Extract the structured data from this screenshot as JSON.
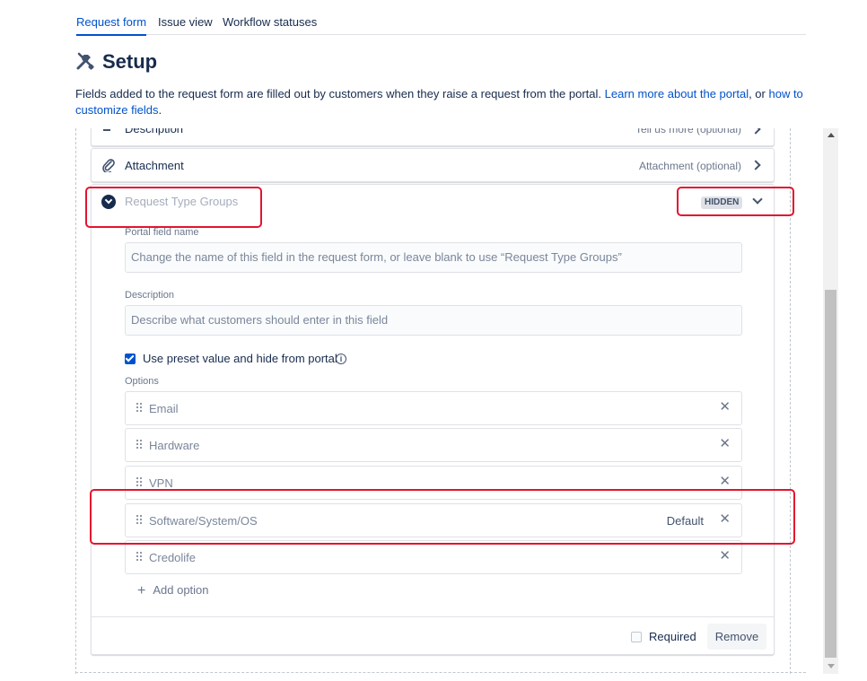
{
  "tabs": [
    {
      "label": "Request form",
      "active": true
    },
    {
      "label": "Issue view",
      "active": false
    },
    {
      "label": "Workflow statuses",
      "active": false
    }
  ],
  "page": {
    "title": "Setup",
    "icon": "tools-icon",
    "intro": {
      "text_before": "Fields added to the request form are filled out by customers when they raise a request from the portal. ",
      "link1": "Learn more about the portal",
      "text_between": ", or ",
      "link2": "how to customize fields",
      "text_after": "."
    }
  },
  "fields": {
    "description": {
      "label": "Description",
      "hint": "Tell us more (optional)"
    },
    "attachment": {
      "label": "Attachment",
      "hint": "Attachment (optional)",
      "icon": "paperclip-icon"
    },
    "expanded": {
      "label": "Request Type Groups",
      "badge": "HIDDEN",
      "portal_field_name_label": "Portal field name",
      "portal_field_name_placeholder": "Change the name of this field in the request form, or leave blank to use “Request Type Groups”",
      "description_label": "Description",
      "description_placeholder": "Describe what customers should enter in this field",
      "preset_checkbox_label": "Use preset value and hide from portal",
      "preset_checked": true,
      "options_label": "Options",
      "options": [
        {
          "label": "Email",
          "default": ""
        },
        {
          "label": "Hardware",
          "default": ""
        },
        {
          "label": "VPN",
          "default": ""
        },
        {
          "label": "Software/System/OS",
          "default": "Default"
        },
        {
          "label": "Credolife",
          "default": ""
        }
      ],
      "add_option_label": "Add option",
      "required_label": "Required",
      "required_checked": false,
      "remove_label": "Remove"
    }
  },
  "colors": {
    "link": "#0052cc",
    "text": "#172b4d",
    "highlight": "#e3142e"
  }
}
